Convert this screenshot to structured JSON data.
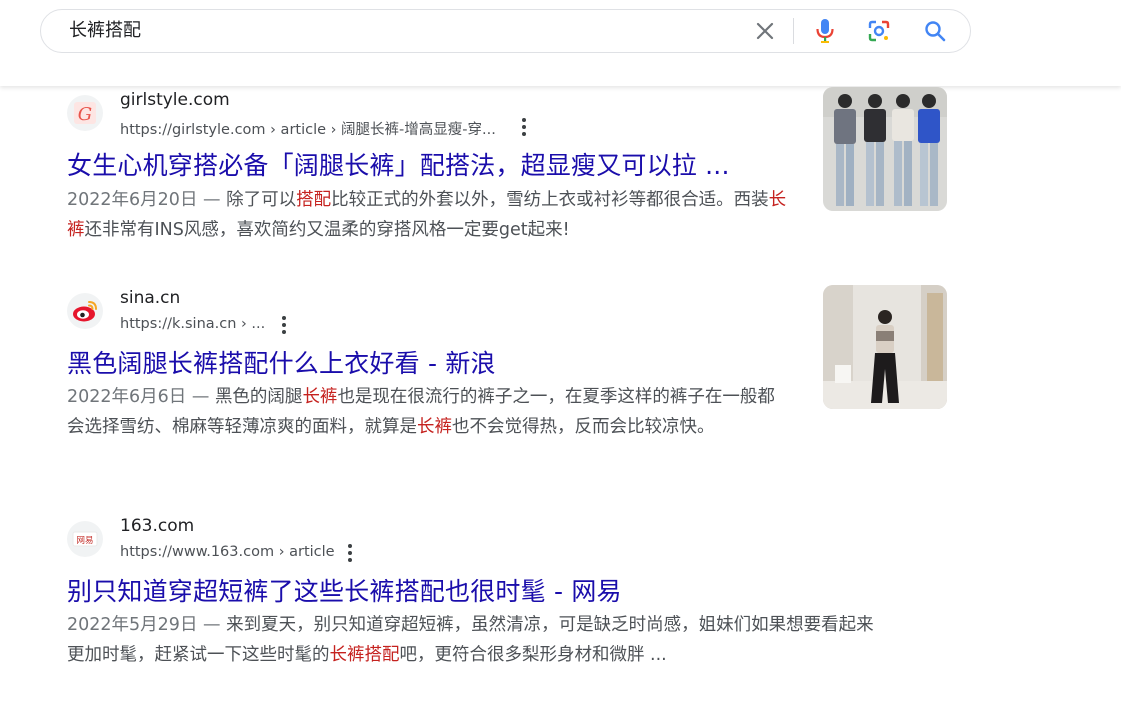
{
  "search": {
    "query": "长裤搭配",
    "clear_icon": "close-icon",
    "mic_icon": "microphone-icon",
    "lens_icon": "camera-lens-icon",
    "search_icon": "search-icon"
  },
  "results": [
    {
      "site_name": "girlstyle.com",
      "url": "https://girlstyle.com › article › 阔腿长裤-增高显瘦-穿...",
      "title": "女生心机穿搭必备「阔腿长裤」配搭法，超显瘦又可以拉 ...",
      "date": "2022年6月20日 — ",
      "snippet_parts": [
        "除了可以",
        "搭配",
        "比较正式的外套以外，雪纺上衣或衬衫等都很合适。西装",
        "长裤",
        "还非常有INS风感，喜欢简约又温柔的穿搭风格一定要get起来!"
      ],
      "favicon_letter": "G",
      "favicon_color": "#e8534a"
    },
    {
      "site_name": "sina.cn",
      "url": "https://k.sina.cn › ...",
      "title": "黑色阔腿长裤搭配什么上衣好看 - 新浪",
      "date": "2022年6月6日 — ",
      "snippet_parts": [
        "黑色的阔腿",
        "长裤",
        "也是现在很流行的裤子之一，在夏季这样的裤子在一般都会选择雪纺、棉麻等轻薄凉爽的面料，就算是",
        "长裤",
        "也不会觉得热，反而会比较凉快。"
      ],
      "favicon_color": "#e6162d"
    },
    {
      "site_name": "163.com",
      "url": "https://www.163.com › article",
      "title": "别只知道穿超短裤了这些长裤搭配也很时髦 - 网易",
      "date": "2022年5月29日 — ",
      "snippet_parts": [
        "来到夏天，别只知道穿超短裤，虽然清凉，可是缺乏时尚感，姐妹们如果想要看起来更加时髦，赶紧试一下这些时髦的",
        "长裤搭配",
        "吧，更符合很多梨形身材和微胖 ..."
      ],
      "favicon_text": "网易",
      "favicon_color": "#c4302b"
    }
  ],
  "colors": {
    "link": "#1a0dab",
    "highlight": "#c5221f",
    "text": "#4d5156"
  }
}
